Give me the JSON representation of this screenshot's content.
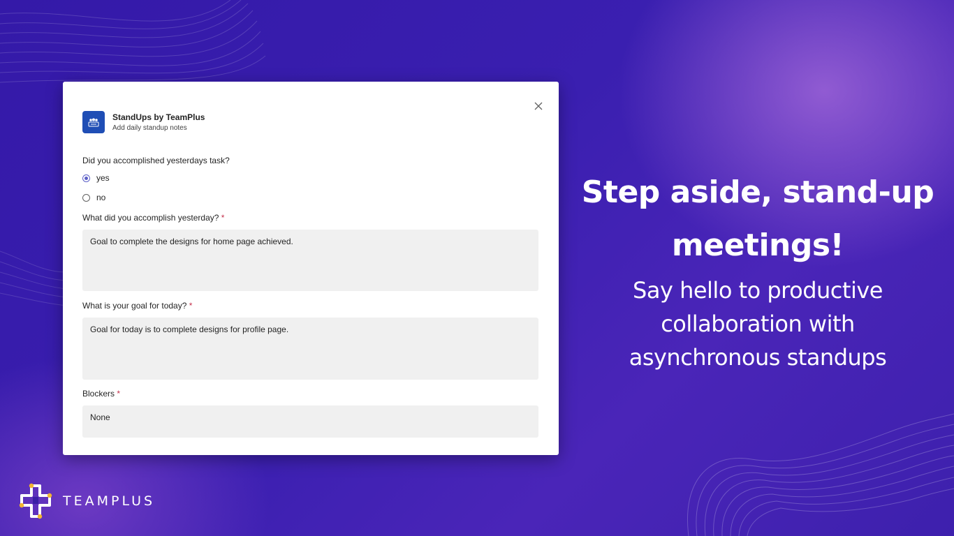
{
  "colors": {
    "background": "#3a1fa6",
    "accent_radio": "#5b5fc7",
    "required": "#c4314b",
    "app_logo": "#1f4eb5",
    "brand_dots": "#f2b531"
  },
  "dialog": {
    "app": {
      "title": "StandUps by TeamPlus",
      "subtitle": "Add daily standup notes",
      "icon": "people-group-icon"
    },
    "close_icon": "close-icon",
    "question": {
      "label": "Did you accomplished yesterdays task?",
      "options": [
        {
          "label": "yes",
          "selected": true
        },
        {
          "label": "no",
          "selected": false
        }
      ]
    },
    "fields": [
      {
        "label": "What did you accomplish yesterday?",
        "required_mark": "*",
        "value": "Goal to complete the designs for home page achieved."
      },
      {
        "label": "What is your goal for today?",
        "required_mark": "*",
        "value": "Goal for today is to complete designs for profile page."
      },
      {
        "label": "Blockers",
        "required_mark": "*",
        "value": "None"
      }
    ]
  },
  "promo": {
    "headline_line1": "Step aside, stand-up",
    "headline_line2": "meetings!",
    "sub_line1": "Say hello to productive",
    "sub_line2": "collaboration with",
    "sub_line3": "asynchronous standups"
  },
  "brand": {
    "name": "TEAMPLUS",
    "icon": "teamplus-logo-icon"
  }
}
